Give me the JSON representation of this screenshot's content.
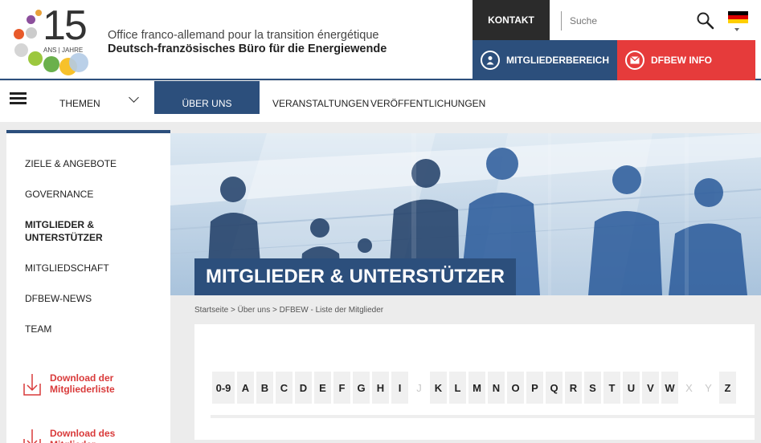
{
  "header": {
    "logo": {
      "number": "15",
      "caption": "ANS | JAHRE"
    },
    "org_fr": "Office franco-allemand pour la transition énergétique",
    "org_de": "Deutsch-französisches Büro für die Energiewende",
    "kontakt_label": "KONTAKT",
    "search_placeholder": "Suche",
    "member_label": "MITGLIEDERBEREICH",
    "info_label": "DFBEW INFO",
    "language_flag": "de-flag-icon"
  },
  "nav": {
    "items": [
      {
        "label": "THEMEN"
      },
      {
        "label": "ÜBER UNS"
      },
      {
        "label": "VERANSTALTUNGEN"
      },
      {
        "label": "VERÖFFENTLICHUNGEN"
      }
    ]
  },
  "sidebar": {
    "items": [
      {
        "label": "ZIELE & ANGEBOTE"
      },
      {
        "label": "GOVERNANCE"
      },
      {
        "label": "MITGLIEDER & UNTERSTÜTZER"
      },
      {
        "label": "MITGLIEDSCHAFT"
      },
      {
        "label": "DFBEW-NEWS"
      },
      {
        "label": "TEAM"
      }
    ],
    "downloads": [
      {
        "label": "Download der Mitgliederliste"
      },
      {
        "label": "Download des Mitglieder-Guides"
      }
    ]
  },
  "hero": {
    "title": "MITGLIEDER & UNTERSTÜTZER"
  },
  "breadcrumb": "Startseite > Über uns > DFBEW - Liste der Mitglieder",
  "alphabet": [
    {
      "label": "0-9",
      "enabled": true
    },
    {
      "label": "A",
      "enabled": true
    },
    {
      "label": "B",
      "enabled": true
    },
    {
      "label": "C",
      "enabled": true
    },
    {
      "label": "D",
      "enabled": true
    },
    {
      "label": "E",
      "enabled": true
    },
    {
      "label": "F",
      "enabled": true
    },
    {
      "label": "G",
      "enabled": true
    },
    {
      "label": "H",
      "enabled": true
    },
    {
      "label": "I",
      "enabled": true
    },
    {
      "label": "J",
      "enabled": false
    },
    {
      "label": "K",
      "enabled": true
    },
    {
      "label": "L",
      "enabled": true
    },
    {
      "label": "M",
      "enabled": true
    },
    {
      "label": "N",
      "enabled": true
    },
    {
      "label": "O",
      "enabled": true
    },
    {
      "label": "P",
      "enabled": true
    },
    {
      "label": "Q",
      "enabled": true
    },
    {
      "label": "R",
      "enabled": true
    },
    {
      "label": "S",
      "enabled": true
    },
    {
      "label": "T",
      "enabled": true
    },
    {
      "label": "U",
      "enabled": true
    },
    {
      "label": "V",
      "enabled": true
    },
    {
      "label": "W",
      "enabled": true
    },
    {
      "label": "X",
      "enabled": false
    },
    {
      "label": "Y",
      "enabled": false
    },
    {
      "label": "Z",
      "enabled": true
    }
  ],
  "colors": {
    "brand_blue": "#2c4f7c",
    "brand_red": "#e63b3b",
    "dark": "#2b2b2b"
  }
}
